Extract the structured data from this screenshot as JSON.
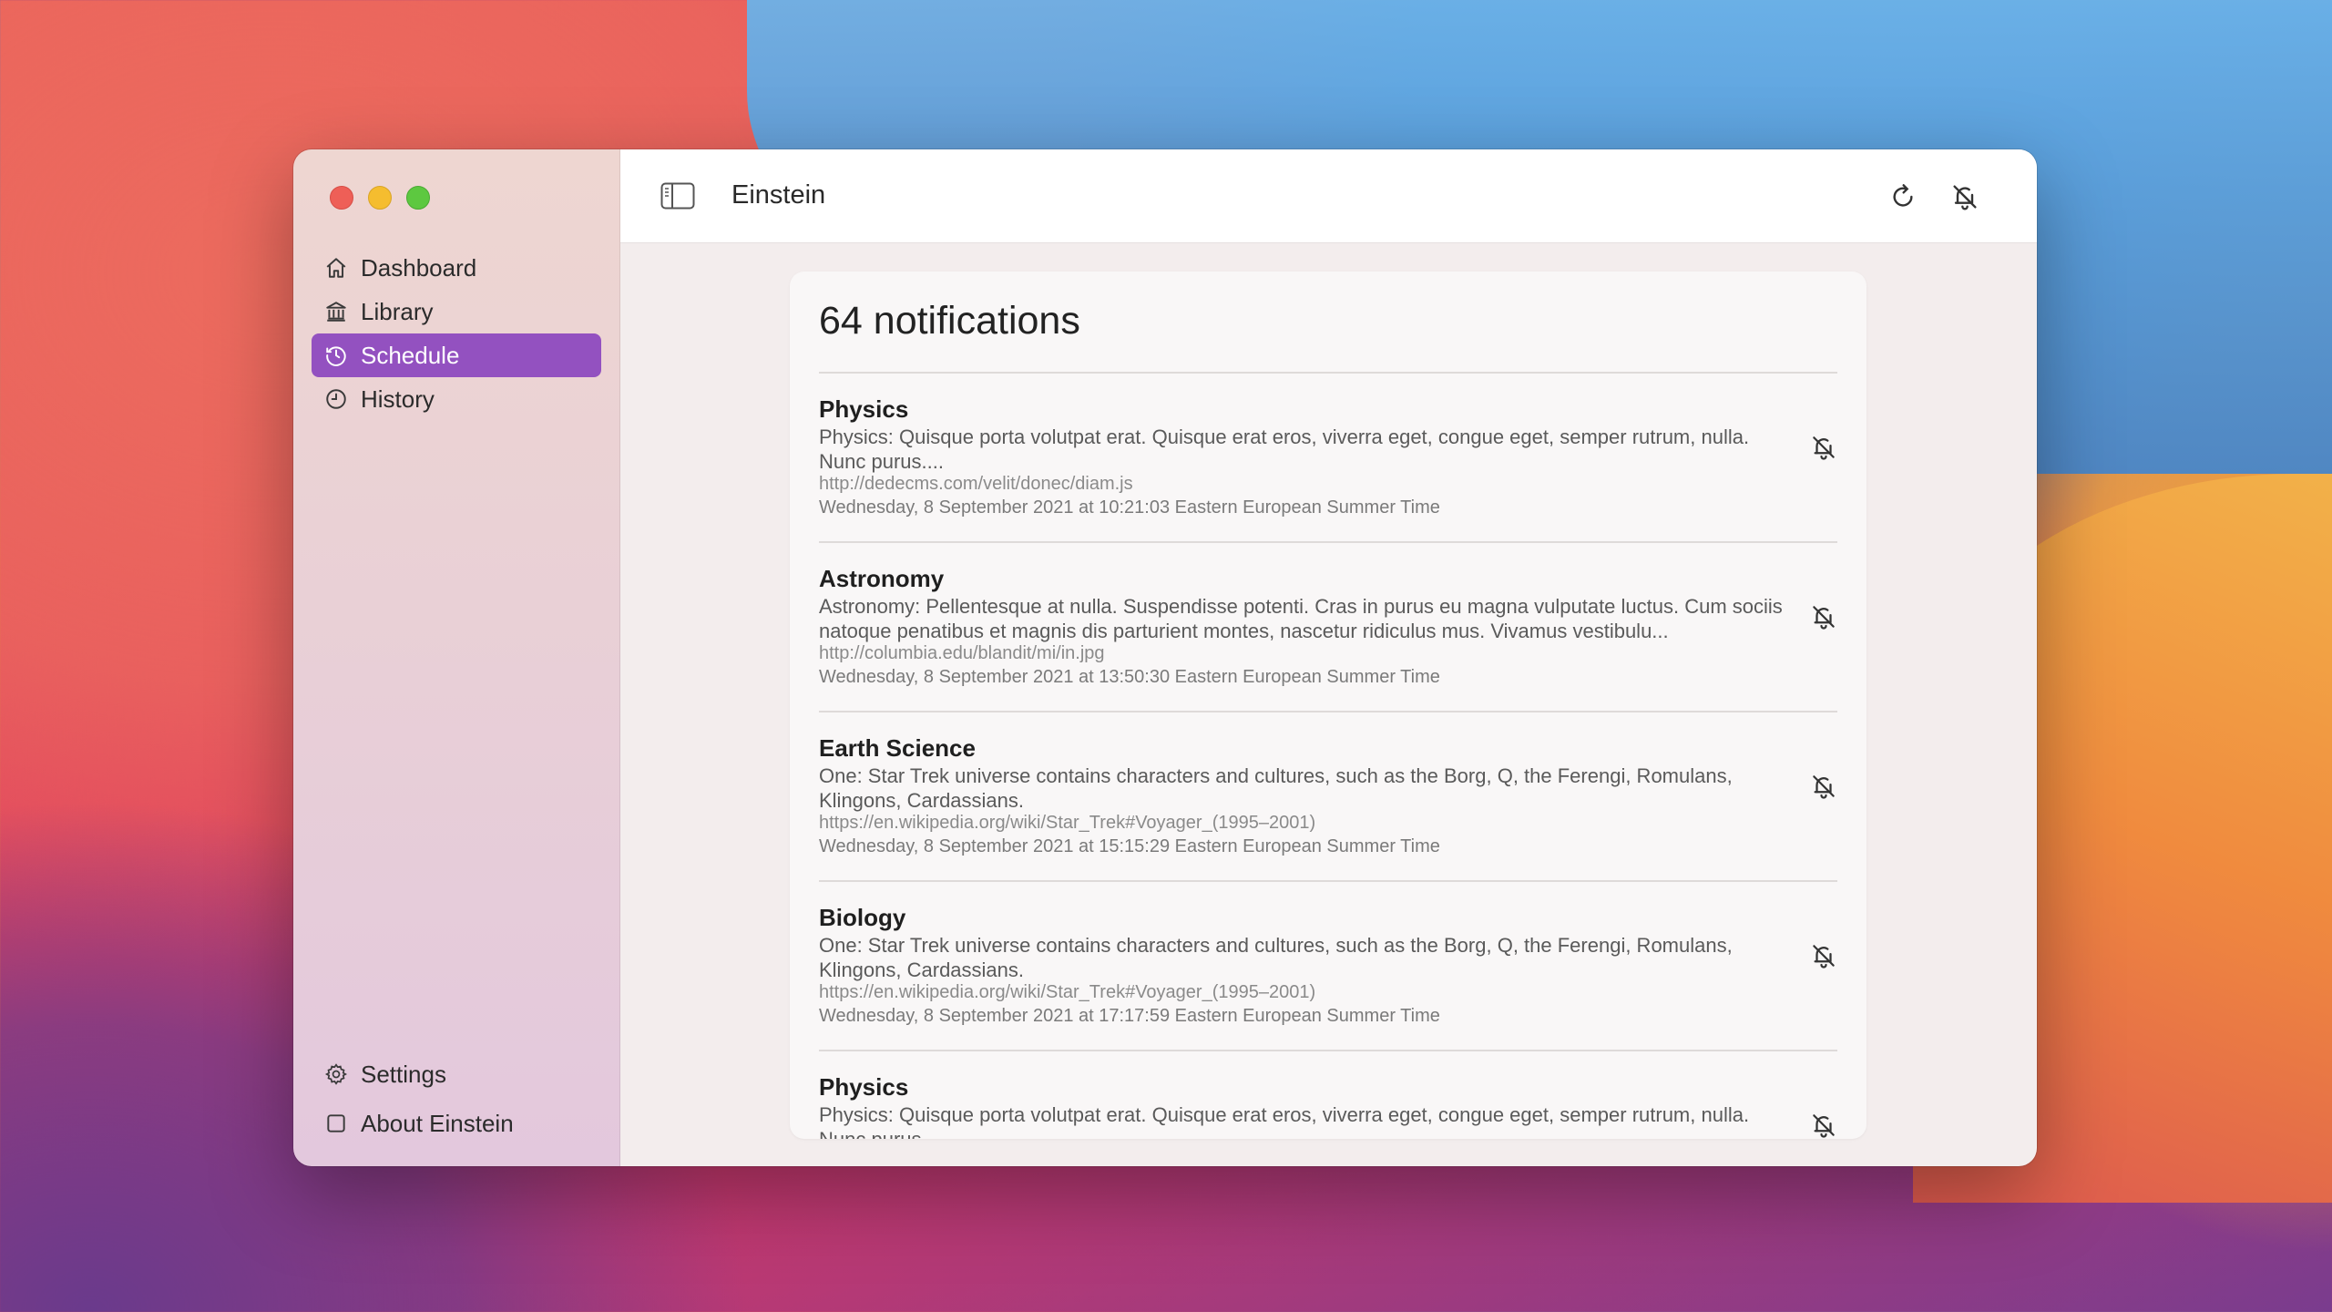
{
  "app": {
    "title": "Einstein"
  },
  "sidebar": {
    "items": [
      {
        "label": "Dashboard",
        "icon": "house-icon"
      },
      {
        "label": "Library",
        "icon": "building-columns-icon"
      },
      {
        "label": "Schedule",
        "icon": "clock-arrow-icon",
        "active": true
      },
      {
        "label": "History",
        "icon": "clock-icon"
      }
    ],
    "bottom": [
      {
        "label": "Settings",
        "icon": "gear-icon"
      },
      {
        "label": "About Einstein",
        "icon": "square-icon"
      }
    ]
  },
  "toolbar": {
    "sidebar_toggle_icon": "sidebar-icon",
    "refresh_icon": "refresh-icon",
    "mute_icon": "bell-slash-icon"
  },
  "main": {
    "count_label": "64 notifications",
    "notifications": [
      {
        "title": "Physics",
        "body": "Physics: Quisque porta volutpat erat. Quisque erat eros, viverra eget, congue eget, semper rutrum, nulla. Nunc purus....",
        "url": "http://dedecms.com/velit/donec/diam.js",
        "date": "Wednesday, 8 September 2021 at 10:21:03 Eastern European Summer Time"
      },
      {
        "title": "Astronomy",
        "body": "Astronomy: Pellentesque at nulla. Suspendisse potenti. Cras in purus eu magna vulputate luctus. Cum sociis natoque penatibus et magnis dis parturient montes, nascetur ridiculus mus. Vivamus vestibulu...",
        "url": "http://columbia.edu/blandit/mi/in.jpg",
        "date": "Wednesday, 8 September 2021 at 13:50:30 Eastern European Summer Time"
      },
      {
        "title": "Earth Science",
        "body": "One: Star Trek universe contains characters and cultures, such as the Borg, Q, the Ferengi, Romulans, Klingons, Cardassians.",
        "url": "https://en.wikipedia.org/wiki/Star_Trek#Voyager_(1995–2001)",
        "date": "Wednesday, 8 September 2021 at 15:15:29 Eastern European Summer Time"
      },
      {
        "title": "Biology",
        "body": "One: Star Trek universe contains characters and cultures, such as the Borg, Q, the Ferengi, Romulans, Klingons, Cardassians.",
        "url": "https://en.wikipedia.org/wiki/Star_Trek#Voyager_(1995–2001)",
        "date": "Wednesday, 8 September 2021 at 17:17:59 Eastern European Summer Time"
      },
      {
        "title": "Physics",
        "body": "Physics: Quisque porta volutpat erat. Quisque erat eros, viverra eget, congue eget, semper rutrum, nulla. Nunc purus....",
        "url": "",
        "date": ""
      }
    ]
  },
  "colors": {
    "accent": "#9351c0",
    "close": "#ee5f57",
    "minimize": "#f5bd2f",
    "maximize": "#5dc840"
  }
}
